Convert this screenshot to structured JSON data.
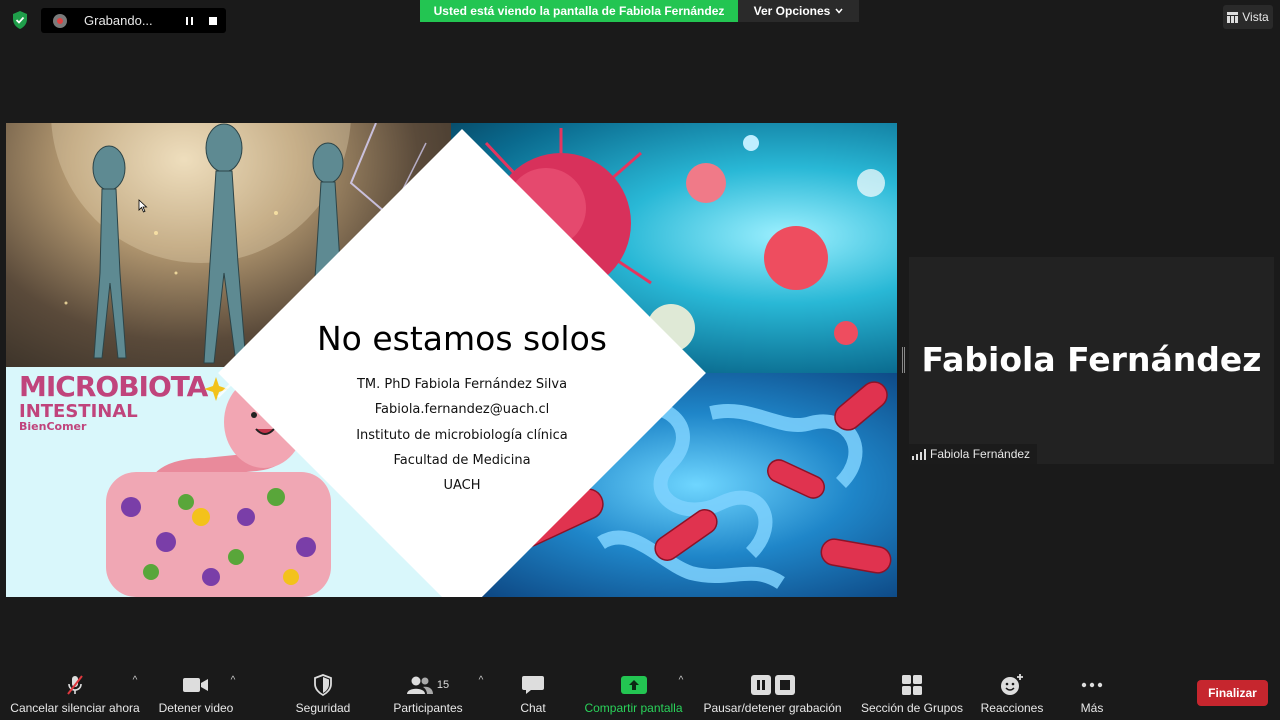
{
  "recording": {
    "label": "Grabando..."
  },
  "share_banner": {
    "text": "Usted está viendo la pantalla de Fabiola Fernández",
    "options_label": "Ver Opciones"
  },
  "view": {
    "label": "Vista"
  },
  "slide": {
    "title": "No estamos solos",
    "lines": [
      "TM. PhD Fabiola Fernández Silva",
      "Fabiola.fernandez@uach.cl",
      "Instituto de microbiología clínica",
      "Facultad de Medicina",
      "UACH"
    ],
    "image_text": {
      "line1": "MICROBIOTA",
      "line2": "INTESTINAL",
      "line3": "BienComer"
    }
  },
  "speaker": {
    "display_name": "Fabiola Fernández",
    "label": "Fabiola Fernández"
  },
  "toolbar": {
    "mute": "Cancelar silenciar ahora",
    "video": "Detener video",
    "security": "Seguridad",
    "participants": "Participantes",
    "participants_count": "15",
    "chat": "Chat",
    "share": "Compartir pantalla",
    "record": "Pausar/detener grabación",
    "breakout": "Sección de Grupos",
    "reactions": "Reacciones",
    "more": "Más",
    "end": "Finalizar"
  },
  "colors": {
    "share_green": "#23c552",
    "end_red": "#c6262e",
    "background": "#1a1a1a"
  }
}
